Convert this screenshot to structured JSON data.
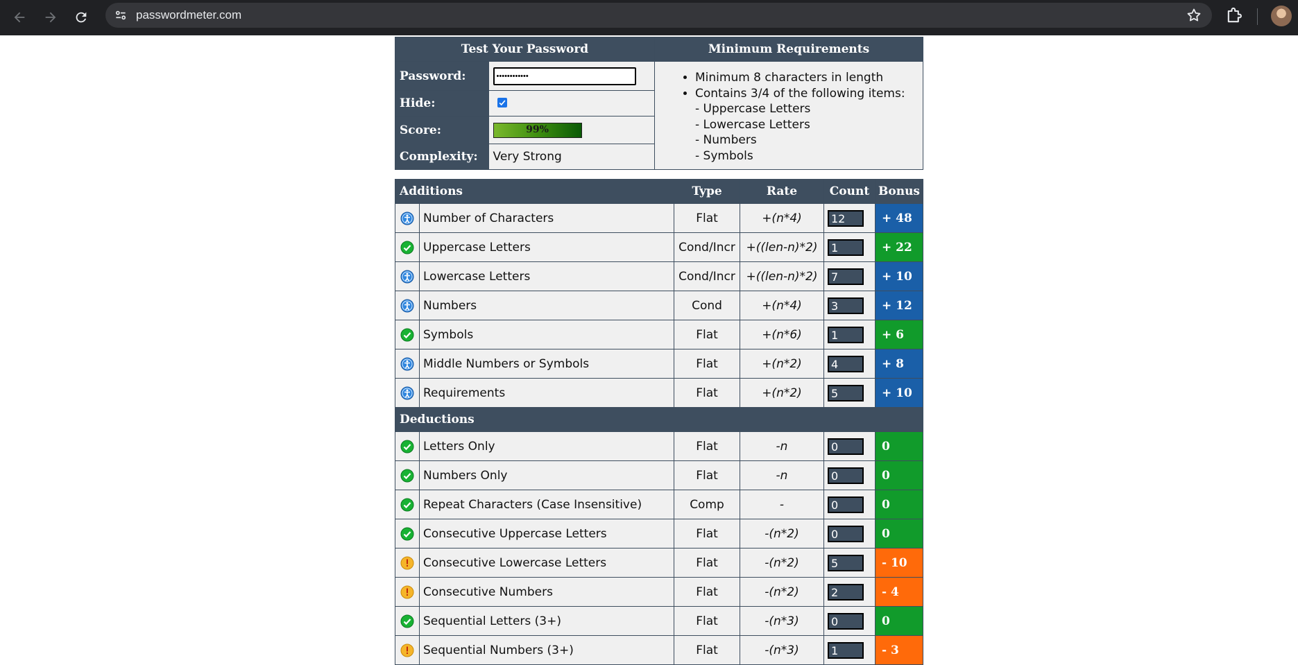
{
  "browser": {
    "url": "passwordmeter.com"
  },
  "test": {
    "header": "Test Your Password",
    "password_label": "Password:",
    "password_value": "••••••••••••",
    "hide_label": "Hide:",
    "hide_checked": true,
    "score_label": "Score:",
    "score_text": "99%",
    "score_value": 0.99,
    "complexity_label": "Complexity:",
    "complexity_value": "Very Strong"
  },
  "requirements": {
    "header": "Minimum Requirements",
    "item1": "Minimum 8 characters in length",
    "item2": "Contains 3/4 of the following items:",
    "sub1": "- Uppercase Letters",
    "sub2": "- Lowercase Letters",
    "sub3": "- Numbers",
    "sub4": "- Symbols"
  },
  "columns": {
    "additions": "Additions",
    "type": "Type",
    "rate": "Rate",
    "count": "Count",
    "bonus": "Bonus",
    "deductions": "Deductions"
  },
  "additions": [
    {
      "status": "exceptional",
      "name": "Number of Characters",
      "type": "Flat",
      "rate": "+(n*4)",
      "count": "12",
      "bonus": "+ 48"
    },
    {
      "status": "sufficient",
      "name": "Uppercase Letters",
      "type": "Cond/Incr",
      "rate": "+((len-n)*2)",
      "count": "1",
      "bonus": "+ 22"
    },
    {
      "status": "exceptional",
      "name": "Lowercase Letters",
      "type": "Cond/Incr",
      "rate": "+((len-n)*2)",
      "count": "7",
      "bonus": "+ 10"
    },
    {
      "status": "exceptional",
      "name": "Numbers",
      "type": "Cond",
      "rate": "+(n*4)",
      "count": "3",
      "bonus": "+ 12"
    },
    {
      "status": "sufficient",
      "name": "Symbols",
      "type": "Flat",
      "rate": "+(n*6)",
      "count": "1",
      "bonus": "+ 6"
    },
    {
      "status": "exceptional",
      "name": "Middle Numbers or Symbols",
      "type": "Flat",
      "rate": "+(n*2)",
      "count": "4",
      "bonus": "+ 8"
    },
    {
      "status": "exceptional",
      "name": "Requirements",
      "type": "Flat",
      "rate": "+(n*2)",
      "count": "5",
      "bonus": "+ 10"
    }
  ],
  "deductions": [
    {
      "status": "sufficient",
      "name": "Letters Only",
      "type": "Flat",
      "rate": "-n",
      "count": "0",
      "bonus": "0"
    },
    {
      "status": "sufficient",
      "name": "Numbers Only",
      "type": "Flat",
      "rate": "-n",
      "count": "0",
      "bonus": "0"
    },
    {
      "status": "sufficient",
      "name": "Repeat Characters (Case Insensitive)",
      "type": "Comp",
      "rate": "-",
      "count": "0",
      "bonus": "0"
    },
    {
      "status": "sufficient",
      "name": "Consecutive Uppercase Letters",
      "type": "Flat",
      "rate": "-(n*2)",
      "count": "0",
      "bonus": "0"
    },
    {
      "status": "warning",
      "name": "Consecutive Lowercase Letters",
      "type": "Flat",
      "rate": "-(n*2)",
      "count": "5",
      "bonus": "- 10"
    },
    {
      "status": "warning",
      "name": "Consecutive Numbers",
      "type": "Flat",
      "rate": "-(n*2)",
      "count": "2",
      "bonus": "- 4"
    },
    {
      "status": "sufficient",
      "name": "Sequential Letters (3+)",
      "type": "Flat",
      "rate": "-(n*3)",
      "count": "0",
      "bonus": "0"
    },
    {
      "status": "warning",
      "name": "Sequential Numbers (3+)",
      "type": "Flat",
      "rate": "-(n*3)",
      "count": "1",
      "bonus": "- 3"
    }
  ],
  "colors": {
    "header_bg": "#3e4e5f",
    "exceptional": "#1a5fa8",
    "sufficient": "#119b2b",
    "warning": "#ff6a0a"
  }
}
